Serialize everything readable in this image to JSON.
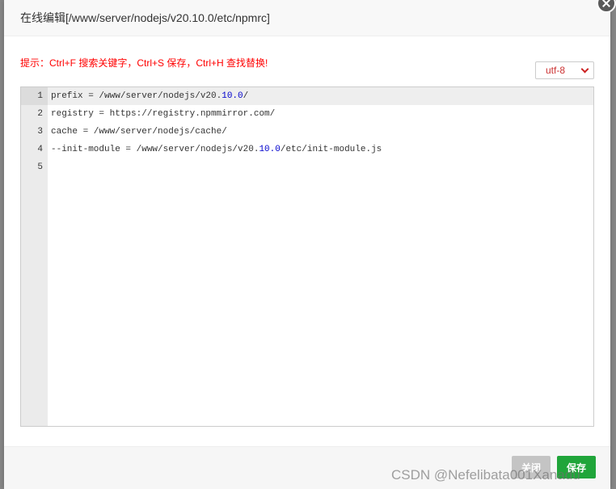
{
  "dialog": {
    "title": "在线编辑[/www/server/nodejs/v20.10.0/etc/npmrc]",
    "tip": "提示：Ctrl+F 搜索关键字，Ctrl+S 保存，Ctrl+H 查找替换!",
    "encoding": {
      "selected": "utf-8"
    },
    "buttons": {
      "close": "关闭",
      "save": "保存"
    }
  },
  "editor": {
    "active_line": 1,
    "lines": [
      {
        "number": 1,
        "tokens": [
          {
            "text": "prefix = /www/server/nodejs/v20.",
            "type": "text"
          },
          {
            "text": "10.0",
            "type": "number"
          },
          {
            "text": "/",
            "type": "text"
          }
        ]
      },
      {
        "number": 2,
        "tokens": [
          {
            "text": "registry = https://registry.npmmirror.com/",
            "type": "text"
          }
        ]
      },
      {
        "number": 3,
        "tokens": [
          {
            "text": "cache = /www/server/nodejs/cache/",
            "type": "text"
          }
        ]
      },
      {
        "number": 4,
        "tokens": [
          {
            "text": "--init-module = /www/server/nodejs/v20.",
            "type": "text"
          },
          {
            "text": "10.0",
            "type": "number"
          },
          {
            "text": "/etc/init-module.js",
            "type": "text"
          }
        ]
      },
      {
        "number": 5,
        "tokens": []
      }
    ]
  },
  "colors": {
    "accent_green": "#20a53a",
    "tip_red": "#ff0000",
    "number_blue": "#0000cd"
  },
  "icons": {
    "close": "close-icon",
    "dropdown": "chevron-down-icon"
  },
  "watermark": "CSDN @Nefelibata001Xanadu"
}
